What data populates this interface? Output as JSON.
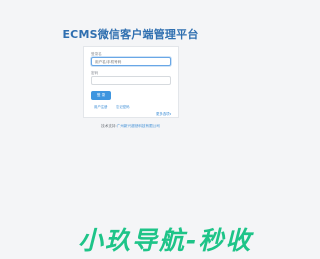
{
  "page": {
    "title": "ECMS微信客户端管理平台"
  },
  "login": {
    "username_label": "登录名",
    "username_placeholder": "用户名/手机号码",
    "password_label": "密码",
    "password_placeholder": "",
    "submit_label": "登 录",
    "register_link": "用户注册",
    "forgot_link": "忘记密码",
    "more_link": "更多选项"
  },
  "footer": {
    "prefix": "技术支持:",
    "company": "广州新兴超然科技有限公司"
  },
  "watermark": {
    "text": "小玖导航-秒收"
  },
  "colors": {
    "title": "#2f6fb0",
    "primary_button": "#3e95df",
    "link": "#3e8ed6",
    "watermark": "#1ec488"
  }
}
